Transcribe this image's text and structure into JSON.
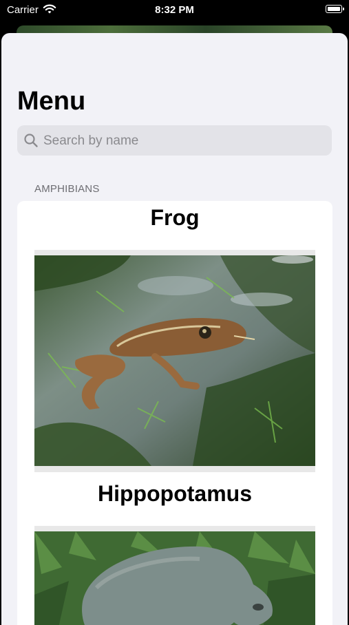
{
  "status_bar": {
    "carrier": "Carrier",
    "time": "8:32 PM"
  },
  "header": {
    "title": "Menu"
  },
  "search": {
    "placeholder": "Search by name",
    "value": ""
  },
  "sections": [
    {
      "header": "AMPHIBIANS",
      "items": [
        {
          "name": "Frog",
          "image": "frog-photo"
        },
        {
          "name": "Hippopotamus",
          "image": "hippo-photo"
        }
      ]
    }
  ],
  "colors": {
    "background": "#f2f2f7",
    "search_field": "#e3e3e8",
    "secondary_text": "#6d6d72"
  }
}
